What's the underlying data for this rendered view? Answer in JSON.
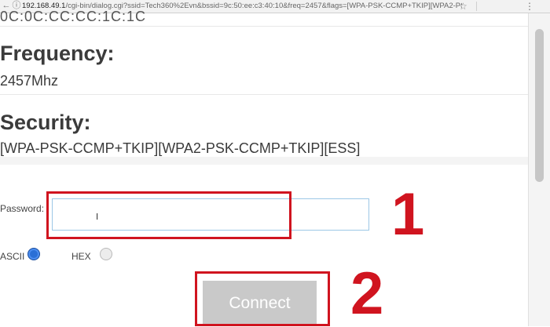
{
  "browser": {
    "url_host": "192.168.49.1",
    "url_path": "/cgi-bin/dialog.cgi?ssid=Tech360%2Evn&bssid=9c:50:ee:c3:40:10&freq=2457&flags=[WPA-PSK-CCMP+TKIP][WPA2-PSK-CC...",
    "back_icon": "back-arrow-icon",
    "info_icon": "info-icon",
    "star_icon": "star-icon",
    "menu_icon": "more-vert-icon"
  },
  "network": {
    "bssid_partial": "0C:0C:CC:CC:1C:1C",
    "frequency_label": "Frequency:",
    "frequency_value": "2457Mhz",
    "security_label": "Security:",
    "security_value": "[WPA-PSK-CCMP+TKIP][WPA2-PSK-CCMP+TKIP][ESS]"
  },
  "form": {
    "password_label": "Password:",
    "password_value": "",
    "ascii_label": "ASCII",
    "hex_label": "HEX",
    "selected_encoding": "ASCII",
    "connect_label": "Connect"
  },
  "annotations": {
    "step1": "1",
    "step2": "2",
    "highlight_color": "#d0141f"
  }
}
